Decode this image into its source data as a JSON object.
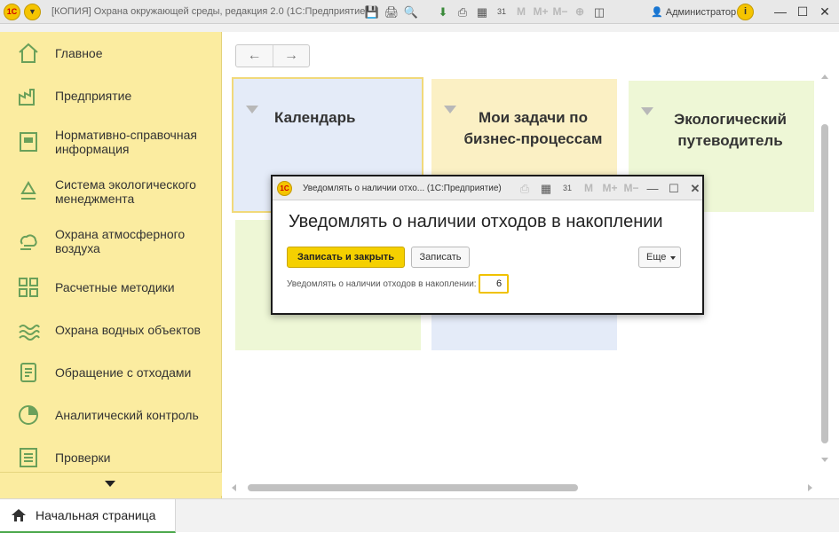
{
  "app": {
    "window_title": "[КОПИЯ] Охрана окружающей среды, редакция 2.0  (1С:Предприятие)",
    "logo_text": "1С",
    "user": "Администратор",
    "toolbar_dim": [
      "M",
      "M+",
      "M−"
    ],
    "calendar_day": "31"
  },
  "sidebar": {
    "items": [
      {
        "label": "Главное",
        "icon": "home-outline-icon"
      },
      {
        "label": "Предприятие",
        "icon": "factory-icon"
      },
      {
        "label": "Нормативно-справочная информация",
        "icon": "reference-book-icon"
      },
      {
        "label": "Система экологического менеджмента",
        "icon": "recycle-icon"
      },
      {
        "label": "Охрана атмосферного воздуха",
        "icon": "cloud-wind-icon"
      },
      {
        "label": "Расчетные методики",
        "icon": "grid-calc-icon"
      },
      {
        "label": "Охрана водных объектов",
        "icon": "water-waves-icon"
      },
      {
        "label": "Обращение с отходами",
        "icon": "waste-document-icon"
      },
      {
        "label": "Аналитический контроль",
        "icon": "pie-chart-icon"
      },
      {
        "label": "Проверки",
        "icon": "checklist-icon"
      }
    ]
  },
  "main": {
    "tiles": [
      {
        "title": "Календарь",
        "color": "#e4ebf8"
      },
      {
        "title": "Мои задачи по бизнес-процессам",
        "color": "#fbf0c4"
      },
      {
        "title": "Экологический путеводитель",
        "color": "#eef7d6"
      }
    ]
  },
  "tabs": {
    "home": "Начальная страница"
  },
  "dialog": {
    "window_title": "Уведомлять о наличии отхо...  (1С:Предприятие)",
    "heading": "Уведомлять о наличии отходов в накоплении",
    "save_close_label": "Записать и закрыть",
    "save_label": "Записать",
    "more_label": "Еще",
    "field_label": "Уведомлять о наличии отходов в накоплении:",
    "field_value": "6",
    "toolbar_dim": [
      "M",
      "M+",
      "M−"
    ]
  }
}
